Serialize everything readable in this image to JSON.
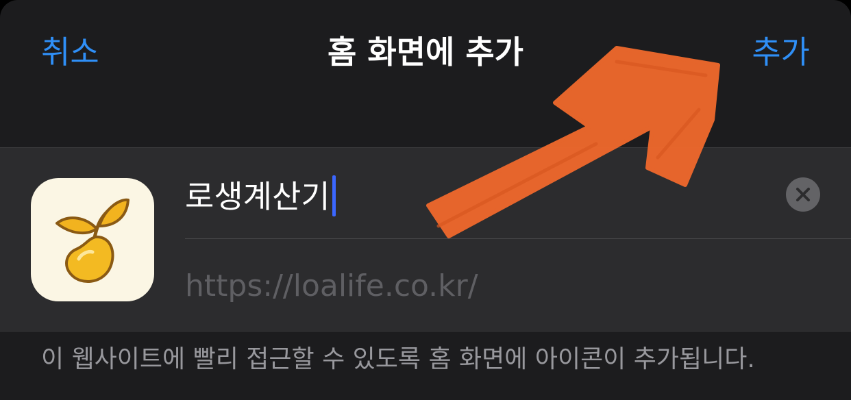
{
  "header": {
    "cancel_label": "취소",
    "title": "홈 화면에 추가",
    "add_label": "추가"
  },
  "app": {
    "icon": "sprout-icon",
    "name_value": "로생계산기",
    "url": "https://loalife.co.kr/",
    "clear_icon": "clear-x-icon"
  },
  "footer": {
    "note": "이 웹사이트에 빨리 접근할 수 있도록 홈 화면에 아이콘이 추가됩니다."
  },
  "annotation": {
    "icon": "hand-drawn-arrow-icon",
    "color": "#f0692c"
  },
  "colors": {
    "accent": "#2f8ff7",
    "background": "#1c1c1e",
    "group_background": "#2c2c2e",
    "caret": "#3b67ff"
  }
}
